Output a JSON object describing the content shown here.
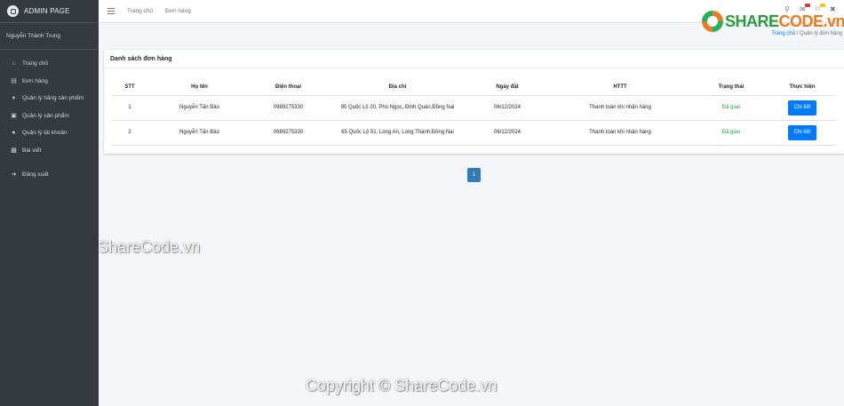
{
  "brand": {
    "title": "ADMIN PAGE"
  },
  "user": {
    "name": "Nguyễn Thành Trung"
  },
  "sidebar": {
    "items": [
      {
        "label": "Trang chủ",
        "icon": "home-icon"
      },
      {
        "label": "Đơn hàng",
        "icon": "receipt-icon"
      },
      {
        "label": "Quản lý hãng sản phẩm",
        "icon": "tag-icon"
      },
      {
        "label": "Quản lý sản phẩm",
        "icon": "box-icon"
      },
      {
        "label": "Quản lý tài khoản",
        "icon": "users-icon"
      },
      {
        "label": "Bài viết",
        "icon": "article-icon"
      },
      {
        "label": "Đăng xuất",
        "icon": "logout-icon"
      }
    ]
  },
  "topbar": {
    "link1": "Trang chủ",
    "link2": "Đơn hàng"
  },
  "logo": {
    "part1": "SHARE",
    "part2": "CODE.vn"
  },
  "breadcrumb": {
    "home": "Trang chủ",
    "sep": "/",
    "current": "Quản lý đơn hàng"
  },
  "card": {
    "title": "Danh sách đơn hàng"
  },
  "table": {
    "headers": [
      "STT",
      "Họ tên",
      "Điện thoại",
      "Địa chỉ",
      "Ngày đặt",
      "HTTT",
      "Trạng thái",
      "Thực hiện"
    ],
    "rows": [
      {
        "stt": "1",
        "name": "Nguyễn Tấn Bảo",
        "phone": "0989275330",
        "address": "95 Quốc Lộ 20, Phú Ngọc, Định Quán,Đồng Nai",
        "date": "06/12/2024",
        "payment": "Thanh toán khi nhận hàng",
        "status": "Đã giao",
        "action": "Chi tiết"
      },
      {
        "stt": "2",
        "name": "Nguyễn Tấn Bảo",
        "phone": "0989275330",
        "address": "65 Quốc Lộ 51, Long An, Long Thành,Đồng Nai",
        "date": "06/12/2024",
        "payment": "Thanh toán khi nhận hàng",
        "status": "Đã giao",
        "action": "Chi tiết"
      }
    ]
  },
  "pagination": {
    "page": "1"
  },
  "watermarks": {
    "center": "ShareCode.vn",
    "bottom": "Copyright © ShareCode.vn"
  },
  "colors": {
    "sidebar": "#343a40",
    "primary": "#007bff",
    "success": "#28a745",
    "pager": "#337ab7"
  }
}
